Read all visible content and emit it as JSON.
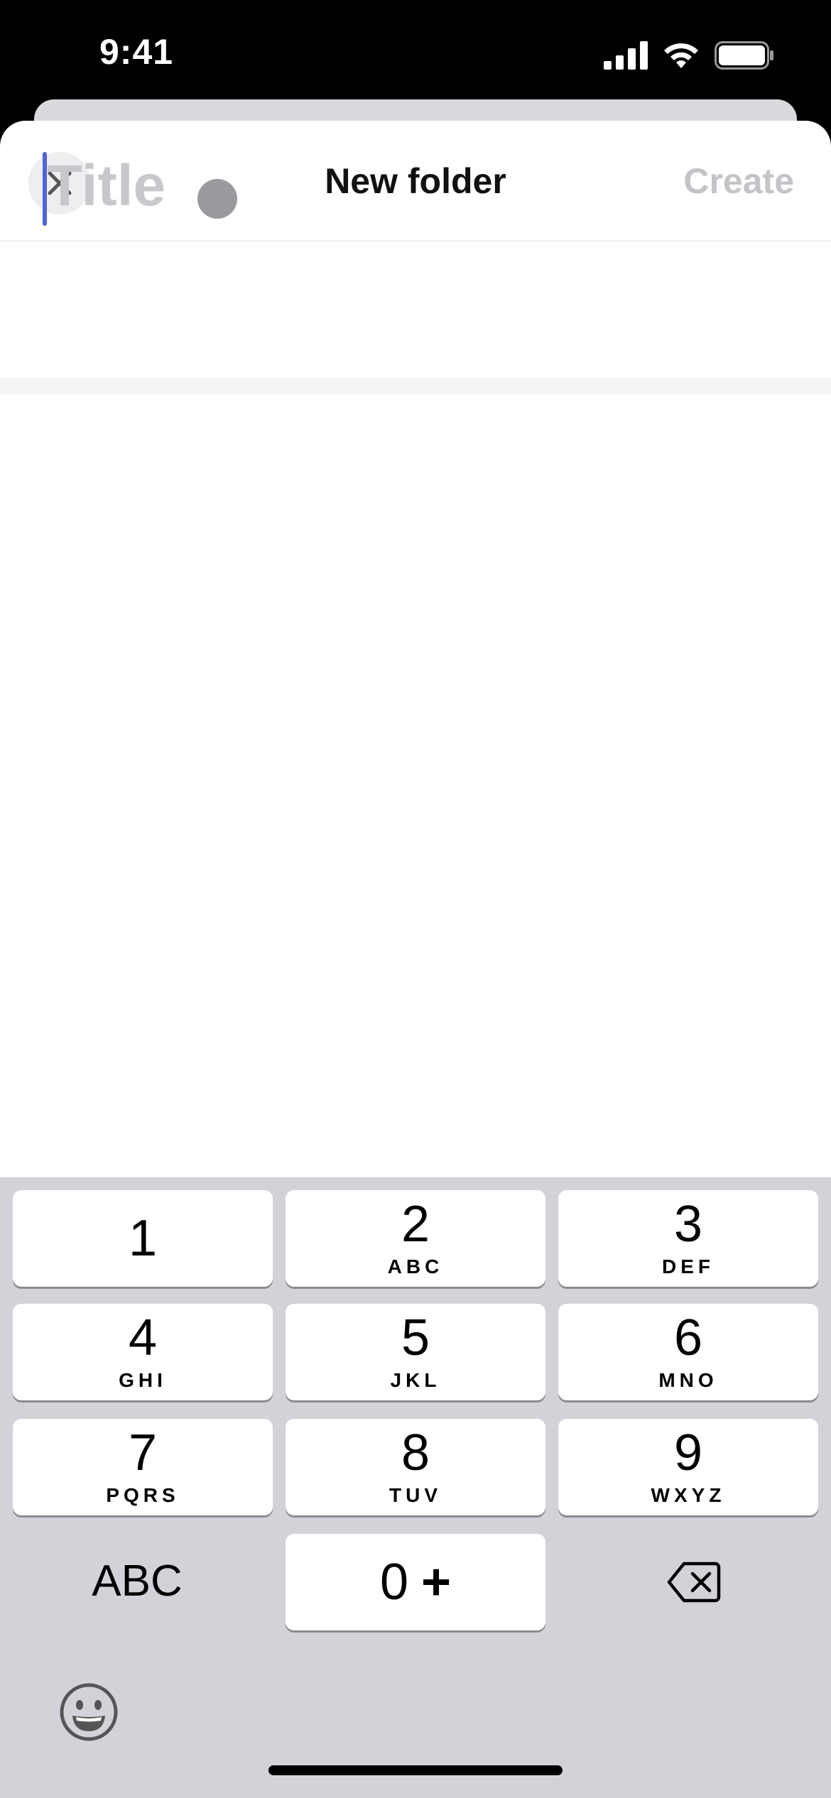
{
  "status_bar": {
    "time": "9:41"
  },
  "nav": {
    "title": "New folder",
    "create_label": "Create"
  },
  "title_field": {
    "placeholder": "Title",
    "value": ""
  },
  "keypad": {
    "keys": [
      {
        "digit": "1",
        "letters": ""
      },
      {
        "digit": "2",
        "letters": "ABC"
      },
      {
        "digit": "3",
        "letters": "DEF"
      },
      {
        "digit": "4",
        "letters": "GHI"
      },
      {
        "digit": "5",
        "letters": "JKL"
      },
      {
        "digit": "6",
        "letters": "MNO"
      },
      {
        "digit": "7",
        "letters": "PQRS"
      },
      {
        "digit": "8",
        "letters": "TUV"
      },
      {
        "digit": "9",
        "letters": "WXYZ"
      }
    ],
    "abc_label": "ABC",
    "zero_label": "0",
    "plus_label": "+"
  },
  "colors": {
    "accent_caret": "#4f63d8",
    "create_disabled": "#c4c4c8",
    "keyboard_bg": "#d1d3d9"
  },
  "icons": [
    "close-icon",
    "cellular-signal-icon",
    "wifi-icon",
    "battery-icon",
    "backspace-icon",
    "emoji-icon"
  ]
}
